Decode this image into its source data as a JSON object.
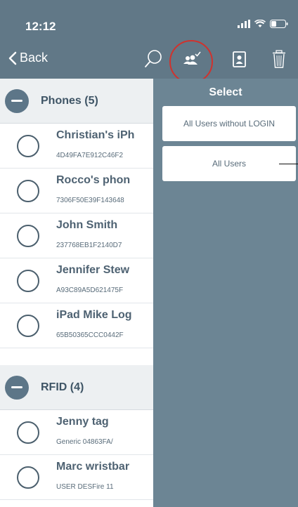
{
  "status": {
    "time": "12:12"
  },
  "nav": {
    "back_label": "Back",
    "icons": [
      "search-icon",
      "select-users-icon",
      "contact-card-icon",
      "trash-icon"
    ]
  },
  "sections": [
    {
      "title": "Phones (5)",
      "rows": [
        {
          "name": "Christian's iPh",
          "sub": "4D49FA7E912C46F2"
        },
        {
          "name": "Rocco's phon",
          "sub": "7306F50E39F143648"
        },
        {
          "name": "John Smith",
          "sub": "237768EB1F2140D7"
        },
        {
          "name": "Jennifer Stew",
          "sub": "A93C89A5D621475F"
        },
        {
          "name": "iPad Mike Log",
          "sub": "65B50365CCC0442F"
        }
      ]
    },
    {
      "title": "RFID (4)",
      "rows": [
        {
          "name": "Jenny tag",
          "sub": "Generic 04863FA/"
        },
        {
          "name": "Marc wristbar",
          "sub": "USER DESFire 11"
        }
      ]
    }
  ],
  "panel": {
    "title": "Select",
    "options": [
      "All Users without LOGIN",
      "All Users"
    ]
  },
  "colors": {
    "header_bg": "#617887",
    "panel_bg": "#6c8594",
    "highlight": "#d0322d"
  }
}
